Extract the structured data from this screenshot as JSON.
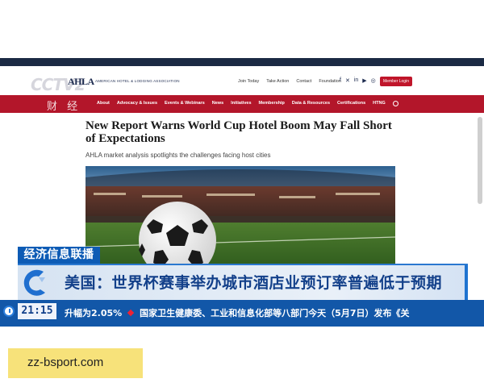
{
  "broadcaster": {
    "logo": "CCTV2",
    "channel_name": "财 经",
    "program_tag": "经济信息联播"
  },
  "site": {
    "logo_mark": "AHLA",
    "logo_text": "AMERICAN HOTEL & LODGING ASSOCIATION",
    "top_links": [
      "Join Today",
      "Take Action",
      "Contact",
      "Foundation"
    ],
    "social_icons": [
      "facebook-icon",
      "x-icon",
      "linkedin-icon",
      "youtube-icon",
      "instagram-icon"
    ],
    "member_login": "Member Login",
    "nav": [
      "About",
      "Advocacy & Issues",
      "Events & Webinars",
      "News",
      "Initiatives",
      "Membership",
      "Data & Resources",
      "Certifications",
      "HTNG"
    ]
  },
  "article": {
    "headline": "New Report Warns World Cup Hotel Boom May Fall Short of Expectations",
    "subhead": "AHLA market analysis spotlights the challenges facing host cities"
  },
  "lower_third": {
    "headline": "美国：世界杯赛事举办城市酒店业预订率普遍低于预期"
  },
  "ticker": {
    "time": "21:15",
    "items": [
      "升幅为2.05%",
      "国家卫生健康委、工业和信息化部等八部门今天（5月7日）发布《关"
    ]
  },
  "watermark": {
    "text": "zz-bsport.com"
  },
  "colors": {
    "nav_red": "#b3162a",
    "ticker_blue": "#1257a8",
    "banner_text": "#13408a",
    "watermark_bg": "#f7e27a"
  }
}
